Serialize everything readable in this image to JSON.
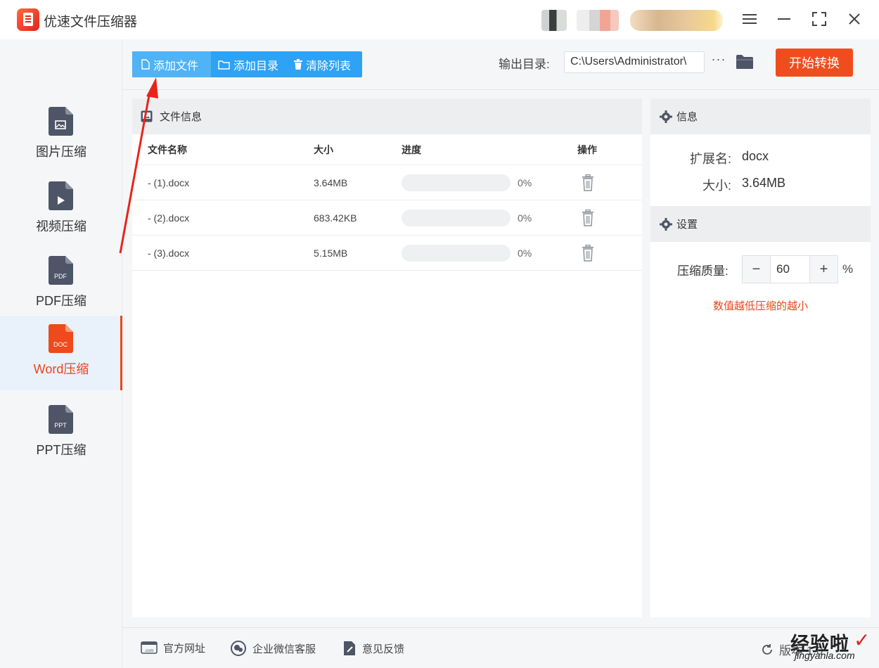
{
  "app": {
    "title": "优速文件压缩器"
  },
  "window": {
    "menu_icon": "hamburger-icon",
    "min_icon": "minimize-icon",
    "max_icon": "fullscreen-icon",
    "close_icon": "close-icon"
  },
  "sidebar": {
    "items": [
      {
        "label": "图片压缩",
        "icon": "image-file-icon",
        "tag": ""
      },
      {
        "label": "视频压缩",
        "icon": "video-file-icon",
        "tag": ""
      },
      {
        "label": "PDF压缩",
        "icon": "pdf-file-icon",
        "tag": "PDF"
      },
      {
        "label": "Word压缩",
        "icon": "doc-file-icon",
        "tag": "DOC",
        "active": true
      },
      {
        "label": "PPT压缩",
        "icon": "ppt-file-icon",
        "tag": "PPT"
      }
    ]
  },
  "toolbar": {
    "add_file": "添加文件",
    "add_dir": "添加目录",
    "clear_list": "清除列表",
    "output_label": "输出目录:",
    "output_path": "C:\\Users\\Administrator\\",
    "more": "···",
    "start": "开始转换"
  },
  "file_panel": {
    "title": "文件信息",
    "columns": [
      "文件名称",
      "大小",
      "进度",
      "操作"
    ],
    "rows": [
      {
        "name": "- (1).docx",
        "size": "3.64MB",
        "progress": "0%",
        "progress_value": 0
      },
      {
        "name": "- (2).docx",
        "size": "683.42KB",
        "progress": "0%",
        "progress_value": 0
      },
      {
        "name": "- (3).docx",
        "size": "5.15MB",
        "progress": "0%",
        "progress_value": 0
      }
    ]
  },
  "info_panel": {
    "title": "信息",
    "ext_label": "扩展名:",
    "ext_value": "docx",
    "size_label": "大小:",
    "size_value": "3.64MB"
  },
  "settings": {
    "title": "设置",
    "quality_label": "压缩质量:",
    "minus": "−",
    "plus": "+",
    "quality_value": "60",
    "unit": "%",
    "hint": "数值越低压缩的越小"
  },
  "footer": {
    "website": "官方网址",
    "wechat": "企业微信客服",
    "feedback": "意见反馈",
    "version": "版本 1.0"
  },
  "watermark": {
    "text": "经验啦",
    "sub": "jingyanla.com",
    "check": "✓"
  },
  "colors": {
    "accent": "#2ea2f4",
    "primary_red": "#f04d1f",
    "active_text": "#e8461a"
  }
}
